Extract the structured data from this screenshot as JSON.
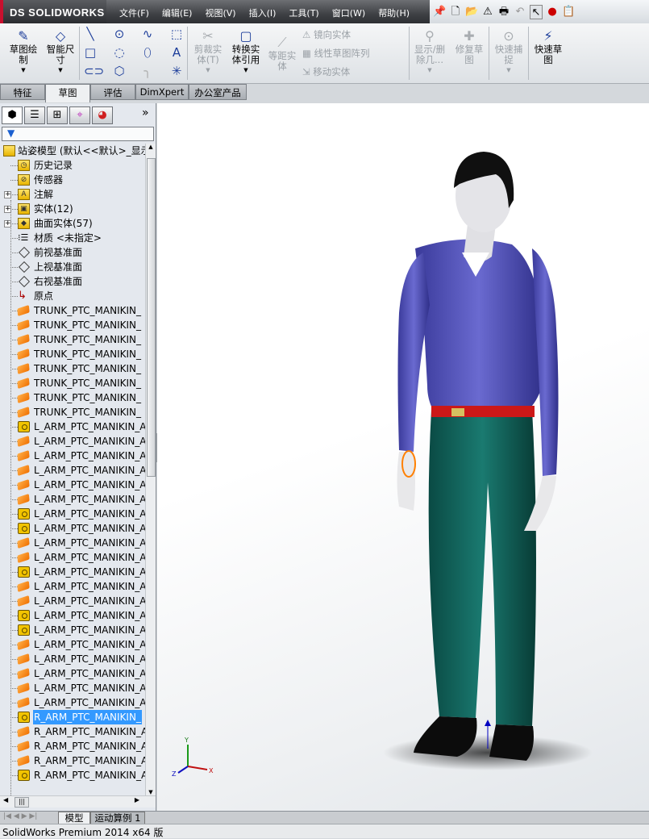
{
  "app": {
    "logo": "SOLIDWORKS",
    "status": "SolidWorks Premium 2014 x64 版"
  },
  "menu": [
    "文件(F)",
    "编辑(E)",
    "视图(V)",
    "插入(I)",
    "工具(T)",
    "窗口(W)",
    "帮助(H)"
  ],
  "ribbon": {
    "sketch": "草图绘\n制",
    "smart_dim": "智能尺\n寸",
    "trim": "剪裁实\n体(T)",
    "convert": "转换实\n体引用",
    "offset": "等距实\n体",
    "mirror": "镜向实体",
    "linear_pattern": "线性草图阵列",
    "move": "移动实体",
    "show_delete": "显示/删\n除几...",
    "repair": "修复草\n图",
    "quick_snap": "快速捕\n捉",
    "rapid_sketch": "快速草\n图"
  },
  "tabs": [
    {
      "label": "特征"
    },
    {
      "label": "草图",
      "active": true
    },
    {
      "label": "评估"
    },
    {
      "label": "DimXpert"
    },
    {
      "label": "办公室产品"
    }
  ],
  "tree": {
    "root": "站姿模型 (默认<<默认>_显示",
    "items": [
      {
        "label": "历史记录",
        "icon": "history-folder"
      },
      {
        "label": "传感器",
        "icon": "sensor-folder"
      },
      {
        "label": "注解",
        "icon": "annotation-folder",
        "expandable": true
      },
      {
        "label": "实体(12)",
        "icon": "solid-bodies-folder",
        "expandable": true
      },
      {
        "label": "曲面实体(57)",
        "icon": "surface-bodies-folder",
        "expandable": true
      },
      {
        "label": "材质 <未指定>",
        "icon": "material"
      },
      {
        "label": "前视基准面",
        "icon": "plane"
      },
      {
        "label": "上视基准面",
        "icon": "plane"
      },
      {
        "label": "右视基准面",
        "icon": "plane"
      },
      {
        "label": "原点",
        "icon": "origin"
      }
    ],
    "bodies": [
      {
        "label": "TRUNK_PTC_MANIKIN_",
        "icon": "surface"
      },
      {
        "label": "TRUNK_PTC_MANIKIN_",
        "icon": "surface"
      },
      {
        "label": "TRUNK_PTC_MANIKIN_",
        "icon": "surface"
      },
      {
        "label": "TRUNK_PTC_MANIKIN_",
        "icon": "surface"
      },
      {
        "label": "TRUNK_PTC_MANIKIN_",
        "icon": "surface"
      },
      {
        "label": "TRUNK_PTC_MANIKIN_",
        "icon": "surface"
      },
      {
        "label": "TRUNK_PTC_MANIKIN_",
        "icon": "surface"
      },
      {
        "label": "TRUNK_PTC_MANIKIN_",
        "icon": "surface"
      },
      {
        "label": "L_ARM_PTC_MANIKIN_A",
        "icon": "solid"
      },
      {
        "label": "L_ARM_PTC_MANIKIN_A",
        "icon": "surface"
      },
      {
        "label": "L_ARM_PTC_MANIKIN_A",
        "icon": "surface"
      },
      {
        "label": "L_ARM_PTC_MANIKIN_A",
        "icon": "surface"
      },
      {
        "label": "L_ARM_PTC_MANIKIN_A",
        "icon": "surface"
      },
      {
        "label": "L_ARM_PTC_MANIKIN_A",
        "icon": "surface"
      },
      {
        "label": "L_ARM_PTC_MANIKIN_A",
        "icon": "solid"
      },
      {
        "label": "L_ARM_PTC_MANIKIN_A",
        "icon": "solid"
      },
      {
        "label": "L_ARM_PTC_MANIKIN_A",
        "icon": "surface"
      },
      {
        "label": "L_ARM_PTC_MANIKIN_A",
        "icon": "surface"
      },
      {
        "label": "L_ARM_PTC_MANIKIN_A",
        "icon": "solid"
      },
      {
        "label": "L_ARM_PTC_MANIKIN_A",
        "icon": "surface"
      },
      {
        "label": "L_ARM_PTC_MANIKIN_A",
        "icon": "surface"
      },
      {
        "label": "L_ARM_PTC_MANIKIN_A",
        "icon": "solid"
      },
      {
        "label": "L_ARM_PTC_MANIKIN_A",
        "icon": "solid"
      },
      {
        "label": "L_ARM_PTC_MANIKIN_A",
        "icon": "surface"
      },
      {
        "label": "L_ARM_PTC_MANIKIN_A",
        "icon": "surface"
      },
      {
        "label": "L_ARM_PTC_MANIKIN_A",
        "icon": "surface"
      },
      {
        "label": "L_ARM_PTC_MANIKIN_A",
        "icon": "surface"
      },
      {
        "label": "L_ARM_PTC_MANIKIN_A",
        "icon": "surface"
      },
      {
        "label": "R_ARM_PTC_MANIKIN_",
        "icon": "solid",
        "selected": true
      },
      {
        "label": "R_ARM_PTC_MANIKIN_A",
        "icon": "surface"
      },
      {
        "label": "R_ARM_PTC_MANIKIN_A",
        "icon": "surface"
      },
      {
        "label": "R_ARM_PTC_MANIKIN_A",
        "icon": "surface"
      },
      {
        "label": "R_ARM_PTC_MANIKIN_A",
        "icon": "solid"
      }
    ]
  },
  "bottom_tabs": [
    {
      "label": "模型",
      "active": true
    },
    {
      "label": "运动算例 1"
    }
  ],
  "triad": {
    "x": "X",
    "y": "Y",
    "z": "Z"
  },
  "colors": {
    "shirt": "#4a4aa8",
    "pants": "#0f5a52",
    "belt": "#d01818",
    "selection": "#3399ff"
  }
}
